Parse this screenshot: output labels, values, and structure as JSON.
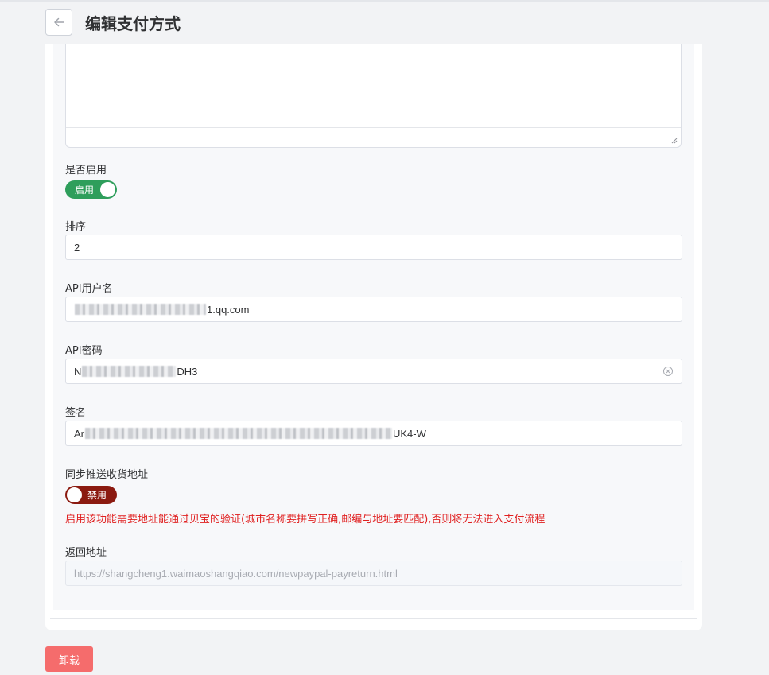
{
  "header": {
    "title": "编辑支付方式"
  },
  "form": {
    "enable": {
      "label": "是否启用",
      "state_text": "启用"
    },
    "sort": {
      "label": "排序",
      "value": "2"
    },
    "api_username": {
      "label": "API用户名",
      "value_suffix": "1.qq.com"
    },
    "api_password": {
      "label": "API密码",
      "value_prefix": "N",
      "value_suffix": "DH3"
    },
    "signature": {
      "label": "签名",
      "value_prefix": "Ar",
      "value_suffix": "UK4-W"
    },
    "sync_address": {
      "label": "同步推送收货地址",
      "state_text": "禁用",
      "warning": "启用该功能需要地址能通过贝宝的验证(城市名称要拼写正确,邮编与地址要匹配),否则将无法进入支付流程"
    },
    "return_url": {
      "label": "返回地址",
      "value": "https://shangcheng1.waimaoshangqiao.com/newpaypal-payreturn.html"
    }
  },
  "footer": {
    "uninstall_label": "卸载"
  },
  "colors": {
    "switch_on": "#2e9e5b",
    "switch_off": "#8b1a10",
    "warning": "#e02020",
    "danger_button": "#f56c6c"
  },
  "icons": {
    "back": "arrow-left-icon",
    "clear": "circle-close-icon",
    "resize": "resize-handle-icon"
  }
}
